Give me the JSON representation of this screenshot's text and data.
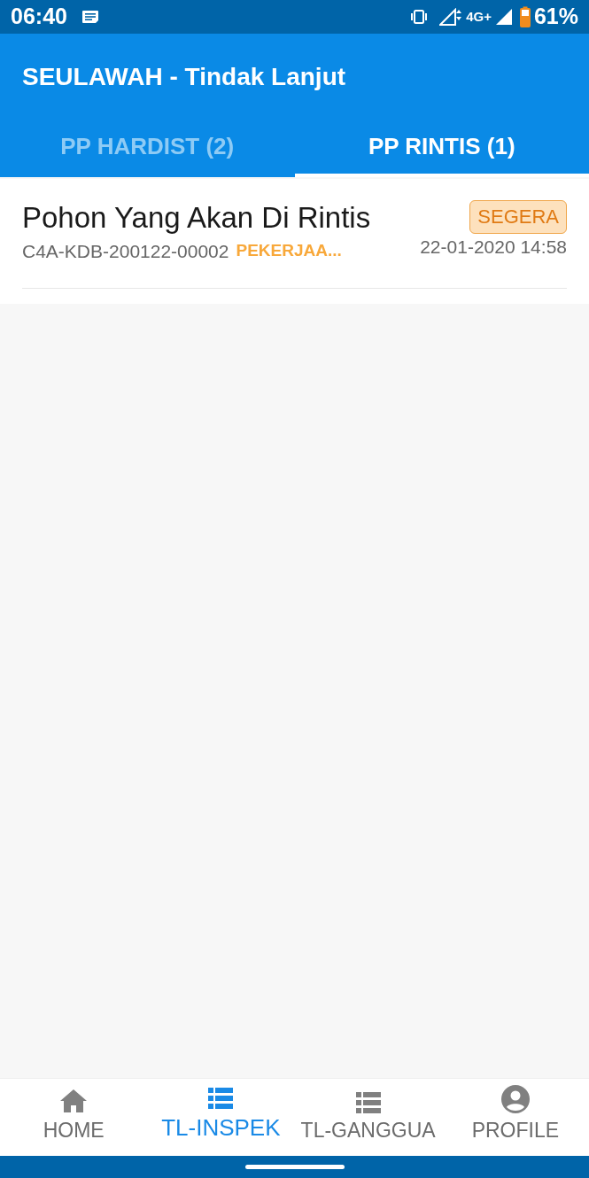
{
  "status_bar": {
    "time": "06:40",
    "network": "4G+",
    "battery": "61%"
  },
  "app_bar": {
    "title": "SEULAWAH - Tindak Lanjut"
  },
  "tabs": [
    {
      "label": "PP HARDIST (2)",
      "selected": false
    },
    {
      "label": "PP RINTIS (1)",
      "selected": true
    }
  ],
  "items": [
    {
      "title": "Pohon Yang Akan Di Rintis",
      "code": "C4A-KDB-200122-00002",
      "status": "PEKERJAA...",
      "badge": "SEGERA",
      "datetime": "22-01-2020 14:58"
    }
  ],
  "bottom_nav": [
    {
      "kind": "home",
      "label": "HOME",
      "selected": false
    },
    {
      "kind": "list",
      "label": "TL-INSPEK",
      "selected": true
    },
    {
      "kind": "list",
      "label": "TL-GANGGUA",
      "selected": false
    },
    {
      "kind": "profile",
      "label": "PROFILE",
      "selected": false
    }
  ]
}
